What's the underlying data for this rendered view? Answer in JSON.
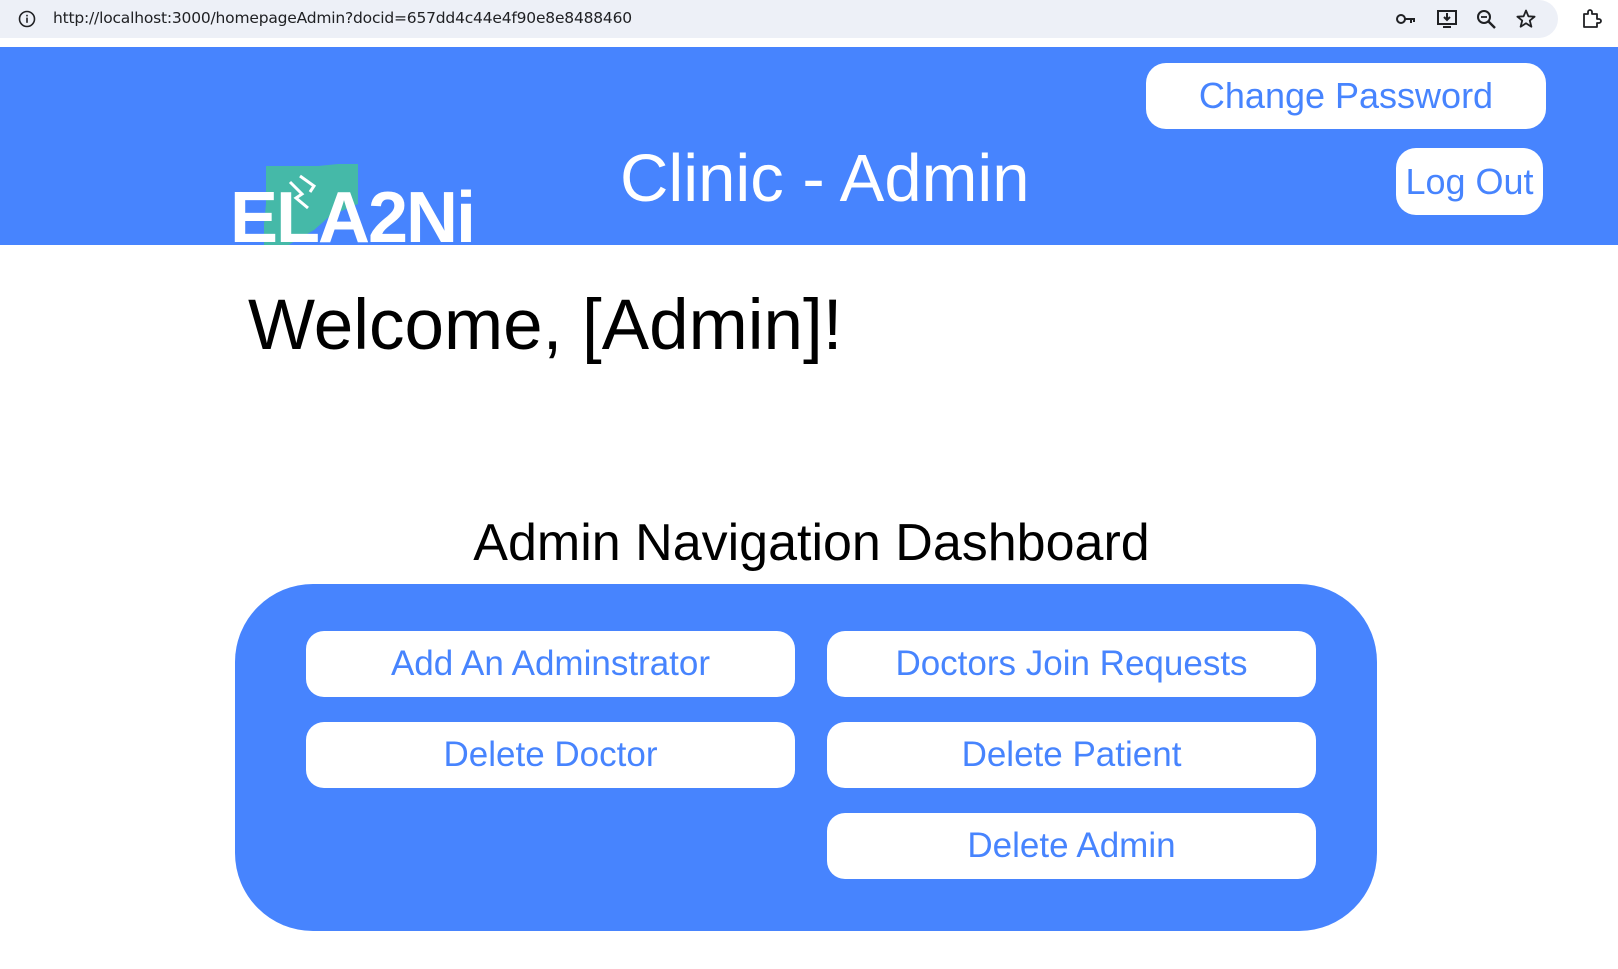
{
  "browser": {
    "url": "http://localhost:3000/homepageAdmin?docid=657dd4c44e4f90e8e8488460",
    "icons": [
      "info-icon",
      "key-icon",
      "install-app-icon",
      "zoom-icon",
      "bookmark-star-icon",
      "extensions-icon"
    ]
  },
  "header": {
    "logo_text": "ELA2Ni",
    "title": "Clinic - Admin",
    "change_password_label": "Change Password",
    "logout_label": "Log Out"
  },
  "main": {
    "welcome": "Welcome, [Admin]!",
    "dashboard_title": "Admin Navigation Dashboard",
    "buttons": {
      "add_admin": "Add An Adminstrator",
      "doctors_join_requests": "Doctors Join Requests",
      "delete_doctor": "Delete Doctor",
      "delete_patient": "Delete Patient",
      "delete_admin": "Delete Admin"
    }
  },
  "colors": {
    "brand_blue": "#4784fe",
    "logo_teal": "#45b9a8",
    "omnibox_bg": "#edf0f7"
  }
}
